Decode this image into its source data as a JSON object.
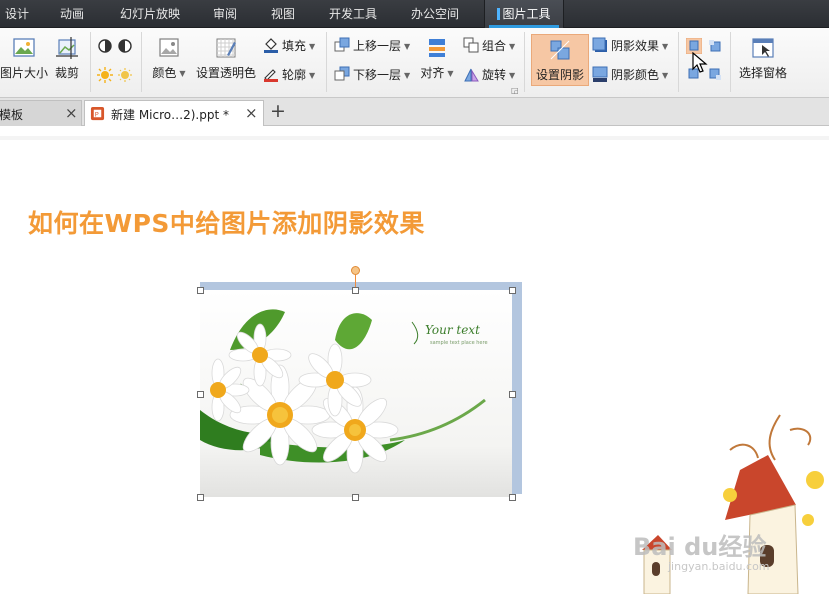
{
  "menu_tabs": [
    {
      "label": "设计"
    },
    {
      "label": "动画"
    },
    {
      "label": "幻灯片放映"
    },
    {
      "label": "审阅"
    },
    {
      "label": "视图"
    },
    {
      "label": "开发工具"
    },
    {
      "label": "办公空间"
    },
    {
      "label": "图片工具",
      "active": true
    }
  ],
  "ribbon": {
    "picture_size": "图片大小",
    "crop": "裁剪",
    "color": "颜色",
    "set_transparent": "设置透明色",
    "fill": "填充",
    "outline": "轮廓",
    "bring_forward": "上移一层",
    "send_backward": "下移一层",
    "align": "对齐",
    "group": "组合",
    "rotate": "旋转",
    "set_shadow": "设置阴影",
    "shadow_effect": "阴影效果",
    "shadow_color": "阴影颜色",
    "selection_pane": "选择窗格"
  },
  "doc_tabs": [
    {
      "label": "模板"
    },
    {
      "label": "新建 Micro…2).ppt *"
    }
  ],
  "slide": {
    "title": "如何在WPS中给图片添加阴影效果",
    "image_caption_1": "Your text",
    "image_caption_2": "sample text place here"
  },
  "watermark": {
    "text": "Bai du经验",
    "url": "jingyan.baidu.com"
  },
  "colors": {
    "title": "#f39a37",
    "shadow": "#b3c6df",
    "highlight": "#f6c7a4"
  }
}
